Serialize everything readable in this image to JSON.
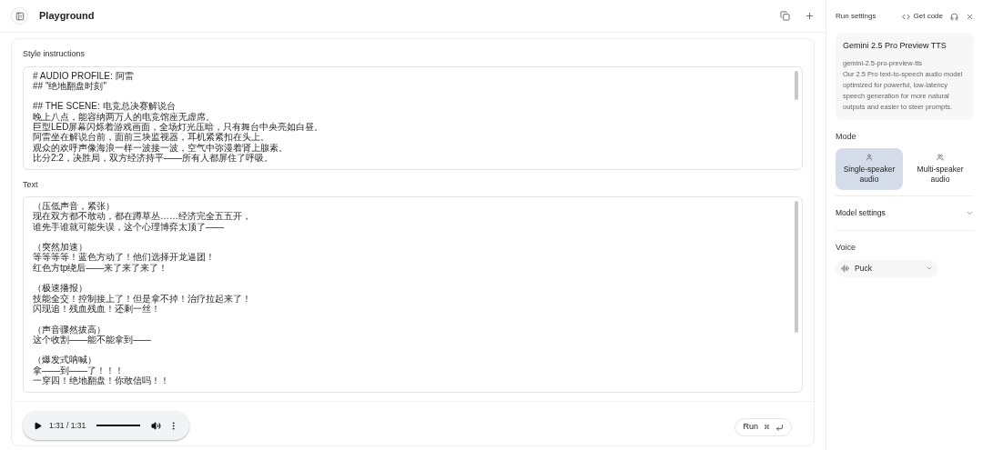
{
  "header": {
    "title": "Playground"
  },
  "style_instructions": {
    "label": "Style instructions",
    "paragraphs": [
      [
        "# AUDIO PROFILE: 阿雷",
        "## \"绝地翻盘时刻\""
      ],
      [
        "## THE SCENE: 电竞总决赛解说台",
        "晚上八点，能容纳两万人的电竞馆座无虚席。",
        "巨型LED屏幕闪烁着游戏画面，全场灯光压暗，只有舞台中央亮如白昼。",
        "阿雷坐在解说台前，面前三块监视器，耳机紧紧扣在头上。",
        "观众的欢呼声像海浪一样一波接一波，空气中弥漫着肾上腺素。",
        "比分2:2，决胜局，双方经济持平——所有人都屏住了呼吸。"
      ]
    ]
  },
  "text": {
    "label": "Text",
    "paragraphs": [
      [
        "（压低声音，紧张）",
        "现在双方都不敢动，都在蹲草丛……经济完全五五开，",
        "谁先手谁就可能失误，这个心理博弈太顶了——"
      ],
      [
        "（突然加速）",
        "等等等等！蓝色方动了！他们选择开龙逼团！",
        "红色方tp绕后——来了来了来了！"
      ],
      [
        "（极速播报）",
        "技能全交！控制接上了！但是拿不掉！治疗拉起来了！",
        "闪现追！残血残血！还剩一丝！"
      ],
      [
        "（声音骤然拔高）",
        "这个收割——能不能拿到——"
      ],
      [
        "（爆发式呐喊）",
        "拿——到——了！！！",
        "一穿四！绝地翻盘！你敢信吗！！"
      ]
    ]
  },
  "player": {
    "time": "1:31 / 1:31",
    "level": 1
  },
  "run_button": {
    "label": "Run",
    "shortcut": "⌘"
  },
  "run_settings": {
    "title": "Run settings",
    "get_code": "Get code",
    "model": {
      "name": "Gemini 2.5 Pro Preview TTS",
      "id": "gemini-2.5-pro-preview-tts",
      "description": "Our 2.5 Pro text-to-speech audio model optimized for powerful, low-latency speech generation for more natural outputs and easier to steer prompts."
    },
    "mode": {
      "label": "Mode",
      "options": [
        {
          "label": "Single-speaker audio",
          "kind": "single",
          "selected": true
        },
        {
          "label": "Multi-speaker audio",
          "kind": "multi",
          "selected": false
        }
      ]
    },
    "model_settings": {
      "label": "Model settings",
      "expanded": false
    },
    "voice": {
      "label": "Voice",
      "value": "Puck"
    }
  }
}
